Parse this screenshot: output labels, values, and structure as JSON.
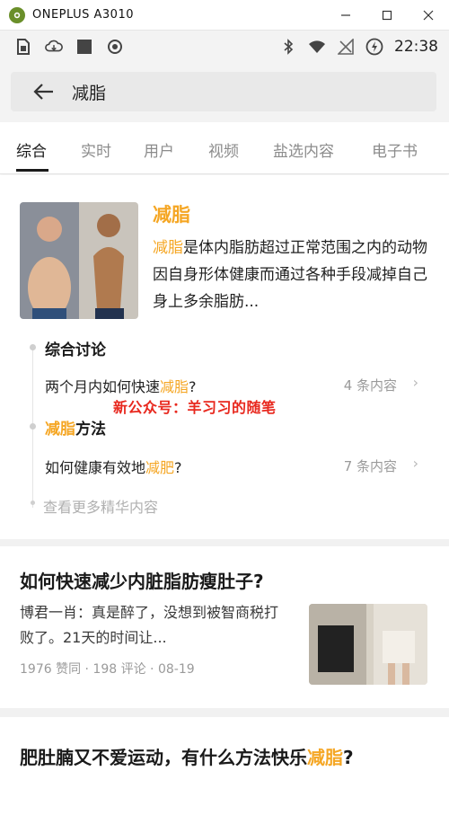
{
  "window": {
    "title": "ONEPLUS A3010",
    "minimize": "—",
    "maximize": "☐",
    "close": "✕"
  },
  "status_bar": {
    "time": "22:38",
    "left_icons": [
      "sim-card-icon",
      "cloud-download-icon",
      "square-app-icon",
      "record-icon"
    ],
    "right_icons": [
      "bluetooth-icon",
      "wifi-icon",
      "no-signal-icon",
      "battery-saver-icon"
    ]
  },
  "search": {
    "query": "减脂"
  },
  "tabs": [
    {
      "label": "综合",
      "active": true
    },
    {
      "label": "实时",
      "active": false
    },
    {
      "label": "用户",
      "active": false
    },
    {
      "label": "视频",
      "active": false
    },
    {
      "label": "盐选内容",
      "active": false
    },
    {
      "label": "电子书",
      "active": false
    }
  ],
  "topic": {
    "name": "减脂",
    "desc_highlight": "减脂",
    "desc_rest": "是体内脂肪超过正常范围之内的动物因自身形体健康而通过各种手段减掉自己身上多余脂肪..."
  },
  "sections": {
    "discussion": {
      "title": "综合讨论",
      "q_prefix": "两个月内如何快速",
      "q_hl": "减脂",
      "q_suffix": "?",
      "count": "4 条内容"
    },
    "method": {
      "title_hl": "减脂",
      "title_rest": "方法",
      "q_prefix": "如何健康有效地",
      "q_hl": "减肥",
      "q_suffix": "?",
      "count": "7 条内容"
    },
    "more": "查看更多精华内容"
  },
  "watermark": "新公众号：羊习习的随笔",
  "articles": [
    {
      "title": "如何快速减少内脏脂肪瘦肚子?",
      "body": "博君一肖：真是醉了，没想到被智商税打败了。21天的时间让...",
      "meta": "1976 赞同 · 198 评论 · 08-19"
    },
    {
      "title_prefix": "肥肚腩又不爱运动，有什么方法快乐",
      "title_hl": "减脂",
      "title_suffix": "?"
    }
  ],
  "colors": {
    "highlight": "#f5a623",
    "watermark": "#e8281e",
    "feed_bg": "#f1f1f1"
  }
}
